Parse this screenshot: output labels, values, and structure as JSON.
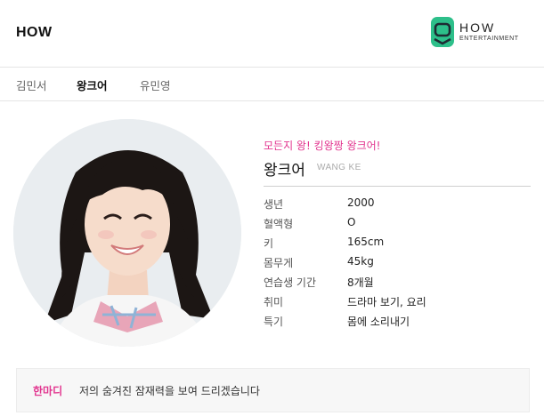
{
  "header": {
    "company": "HOW",
    "logo": {
      "word": "HOW",
      "sub": "ENTERTAINMENT",
      "color": "#2dbf8a"
    }
  },
  "tabs": [
    {
      "label": "김민서",
      "active": false
    },
    {
      "label": "왕크어",
      "active": true
    },
    {
      "label": "유민영",
      "active": false
    }
  ],
  "profile": {
    "tagline": "모든지 왕! 킹왕짱 왕크어!",
    "name": "왕크어",
    "name_en": "WANG KE",
    "info": [
      {
        "key": "생년",
        "value": "2000"
      },
      {
        "key": "혈액형",
        "value": "O"
      },
      {
        "key": "키",
        "value": "165cm"
      },
      {
        "key": "몸무게",
        "value": "45kg"
      },
      {
        "key": "연습생 기간",
        "value": "8개월"
      },
      {
        "key": "취미",
        "value": "드라마 보기, 요리"
      },
      {
        "key": "특기",
        "value": "몸에 소리내기"
      }
    ]
  },
  "comment": {
    "label": "한마디",
    "text": "저의 숨겨진 잠재력을 보여 드리겠습니다"
  },
  "colors": {
    "accent": "#e2358f",
    "divider": "#e4e4e4"
  }
}
